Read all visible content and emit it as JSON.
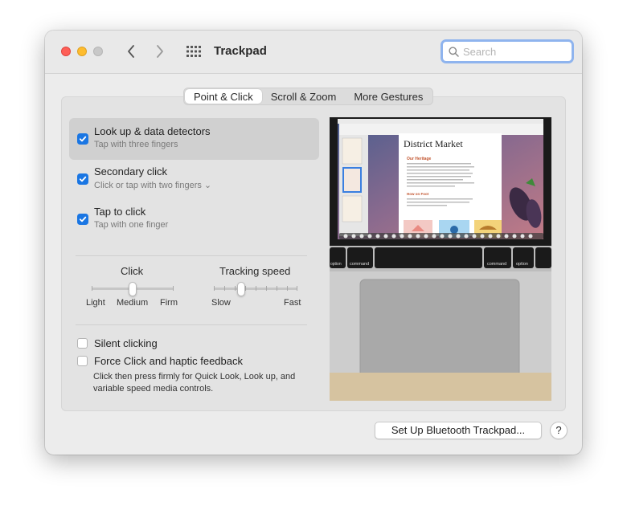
{
  "window": {
    "title": "Trackpad"
  },
  "search": {
    "placeholder": "Search",
    "value": ""
  },
  "tabs": [
    {
      "label": "Point & Click",
      "active": true
    },
    {
      "label": "Scroll & Zoom",
      "active": false
    },
    {
      "label": "More Gestures",
      "active": false
    }
  ],
  "options": [
    {
      "title": "Look up & data detectors",
      "subtitle": "Tap with three fingers",
      "checked": true,
      "selected": true
    },
    {
      "title": "Secondary click",
      "subtitle": "Click or tap with two fingers ⌄",
      "checked": true,
      "selected": false
    },
    {
      "title": "Tap to click",
      "subtitle": "Tap with one finger",
      "checked": true,
      "selected": false
    }
  ],
  "sliders": {
    "click": {
      "label": "Click",
      "min_label": "Light",
      "mid_label": "Medium",
      "max_label": "Firm",
      "value_fraction": 0.5
    },
    "tracking": {
      "label": "Tracking speed",
      "min_label": "Slow",
      "max_label": "Fast",
      "value_fraction": 0.33
    }
  },
  "checkboxes": [
    {
      "label": "Silent clicking",
      "checked": false
    },
    {
      "label": "Force Click and haptic feedback",
      "checked": false
    }
  ],
  "force_click_description": "Click then press firmly for Quick Look, Look up, and variable speed media controls.",
  "preview": {
    "document_title": "District Market",
    "heading1": "Our Heritage",
    "heading2": "How on Foot",
    "key_left": "command",
    "key_right": "command",
    "key_far_left": "option",
    "key_far_right": "option"
  },
  "footer": {
    "bluetooth_button": "Set Up Bluetooth Trackpad...",
    "help_button": "?"
  },
  "colors": {
    "accent": "#1a76e3",
    "close": "#fe5f57",
    "minimize": "#febc2e",
    "maximize": "#c8c8c8"
  }
}
